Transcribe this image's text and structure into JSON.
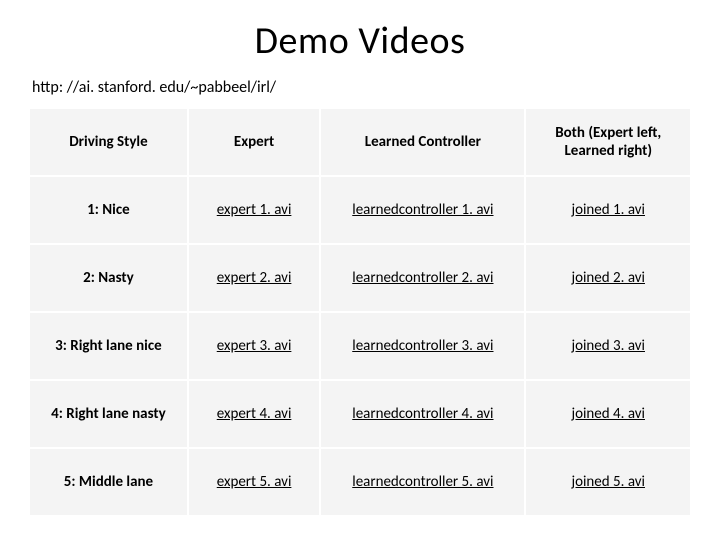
{
  "title": "Demo Videos",
  "url": "http: //ai. stanford. edu/~pabbeel/irl/",
  "headers": {
    "style": "Driving Style",
    "expert": "Expert",
    "learned": "Learned Controller",
    "both": "Both (Expert left, Learned right)"
  },
  "rows": [
    {
      "style": "1: Nice",
      "expert": "expert 1. avi",
      "learned": "learnedcontroller 1. avi",
      "both": "joined 1. avi"
    },
    {
      "style": "2: Nasty",
      "expert": "expert 2. avi",
      "learned": "learnedcontroller 2. avi",
      "both": "joined 2. avi"
    },
    {
      "style": "3: Right lane nice",
      "expert": "expert 3. avi",
      "learned": "learnedcontroller 3. avi",
      "both": "joined 3. avi"
    },
    {
      "style": "4: Right lane nasty",
      "expert": "expert 4. avi",
      "learned": "learnedcontroller 4. avi",
      "both": "joined 4. avi"
    },
    {
      "style": "5: Middle lane",
      "expert": "expert 5. avi",
      "learned": "learnedcontroller 5. avi",
      "both": "joined 5. avi"
    }
  ]
}
